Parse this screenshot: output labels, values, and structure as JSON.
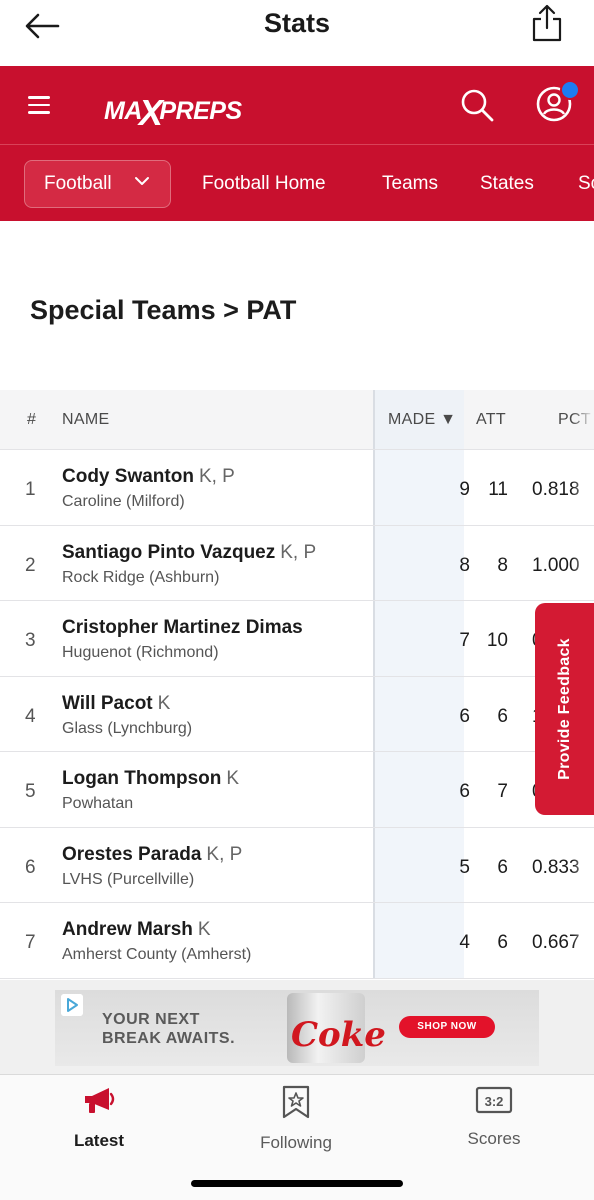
{
  "appbar": {
    "title": "Stats"
  },
  "brand": {
    "logo": "MAXPREPS",
    "color": "#c8102e",
    "notification_color": "#1d7cf2"
  },
  "sport_nav": {
    "selected_sport": "Football",
    "links": [
      "Football Home",
      "Teams",
      "States",
      "Sc"
    ]
  },
  "page": {
    "heading": "Special Teams > PAT"
  },
  "table": {
    "columns": {
      "rank": "#",
      "name": "NAME",
      "made": "MADE ▼",
      "att": "ATT",
      "pct": "PCT"
    },
    "rows": [
      {
        "rank": "1",
        "name": "Cody Swanton",
        "pos": "K, P",
        "school": "Caroline (Milford)",
        "made": "9",
        "att": "11",
        "pct": "0.818"
      },
      {
        "rank": "2",
        "name": "Santiago Pinto Vazquez",
        "pos": "K, P",
        "school": "Rock Ridge (Ashburn)",
        "made": "8",
        "att": "8",
        "pct": "1.000"
      },
      {
        "rank": "3",
        "name": "Cristopher Martinez Dimas",
        "pos": "",
        "school": "Huguenot (Richmond)",
        "made": "7",
        "att": "10",
        "pct": "0"
      },
      {
        "rank": "4",
        "name": "Will Pacot",
        "pos": "K",
        "school": "Glass (Lynchburg)",
        "made": "6",
        "att": "6",
        "pct": "1"
      },
      {
        "rank": "5",
        "name": "Logan Thompson",
        "pos": "K",
        "school": "Powhatan",
        "made": "6",
        "att": "7",
        "pct": "0"
      },
      {
        "rank": "6",
        "name": "Orestes Parada",
        "pos": "K, P",
        "school": "LVHS (Purcellville)",
        "made": "5",
        "att": "6",
        "pct": "0.833"
      },
      {
        "rank": "7",
        "name": "Andrew Marsh",
        "pos": "K",
        "school": "Amherst County (Amherst)",
        "made": "4",
        "att": "6",
        "pct": "0.667"
      }
    ]
  },
  "feedback": {
    "label": "Provide Feedback"
  },
  "ad": {
    "headline_1": "YOUR NEXT",
    "headline_2": "BREAK AWAITS.",
    "brand": "Coke",
    "cta": "SHOP NOW"
  },
  "tabs": [
    {
      "label": "Latest",
      "icon": "megaphone-icon",
      "active": true
    },
    {
      "label": "Following",
      "icon": "bookmark-star-icon",
      "active": false
    },
    {
      "label": "Scores",
      "icon": "scoreboard-icon",
      "active": false
    }
  ]
}
